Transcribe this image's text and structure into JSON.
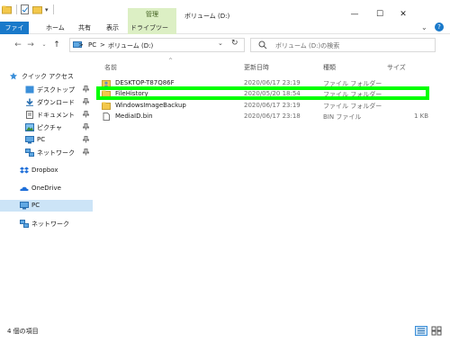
{
  "window": {
    "manage_tab": "管理",
    "title": "ボリューム (D:)",
    "minimize": "—",
    "maximize": "☐",
    "close": "✕"
  },
  "ribbon": {
    "tabs": [
      "ファイル",
      "ホーム",
      "共有",
      "表示",
      "ドライブツール"
    ]
  },
  "address": {
    "crumbs": [
      "PC",
      "ボリューム (D:)"
    ],
    "separator": ">",
    "search_placeholder": "ボリューム (D:)の検索"
  },
  "nav": {
    "quick_access": "クイック アクセス",
    "items": [
      {
        "label": "デスクトップ",
        "icon": "desktop-icon"
      },
      {
        "label": "ダウンロード",
        "icon": "download-icon"
      },
      {
        "label": "ドキュメント",
        "icon": "documents-icon"
      },
      {
        "label": "ピクチャ",
        "icon": "pictures-icon"
      },
      {
        "label": "PC",
        "icon": "pc-icon"
      },
      {
        "label": "ネットワーク",
        "icon": "network-icon"
      }
    ],
    "dropbox": "Dropbox",
    "onedrive": "OneDrive",
    "pc": "PC",
    "network": "ネットワーク"
  },
  "columns": {
    "name": "名前",
    "modified": "更新日時",
    "type": "種類",
    "size": "サイズ"
  },
  "files": [
    {
      "name": "DESKTOP-T87Q86F",
      "modified": "2020/06/17 23:19",
      "type": "ファイル フォルダー",
      "size": "",
      "icon": "user-folder-icon"
    },
    {
      "name": "FileHistory",
      "modified": "2020/05/20 18:54",
      "type": "ファイル フォルダー",
      "size": "",
      "icon": "folder-icon"
    },
    {
      "name": "WindowsImageBackup",
      "modified": "2020/06/17 23:19",
      "type": "ファイル フォルダー",
      "size": "",
      "icon": "folder-icon"
    },
    {
      "name": "MediaID.bin",
      "modified": "2020/06/17 23:18",
      "type": "BIN ファイル",
      "size": "1 KB",
      "icon": "file-icon"
    }
  ],
  "status": {
    "item_count": "4 個の項目"
  },
  "colors": {
    "accent": "#1979ca",
    "manage_tab_bg": "#dcefc4",
    "highlight_box": "#00ff00",
    "selected_nav": "#cce4f7",
    "folder": "#f3c84b"
  }
}
